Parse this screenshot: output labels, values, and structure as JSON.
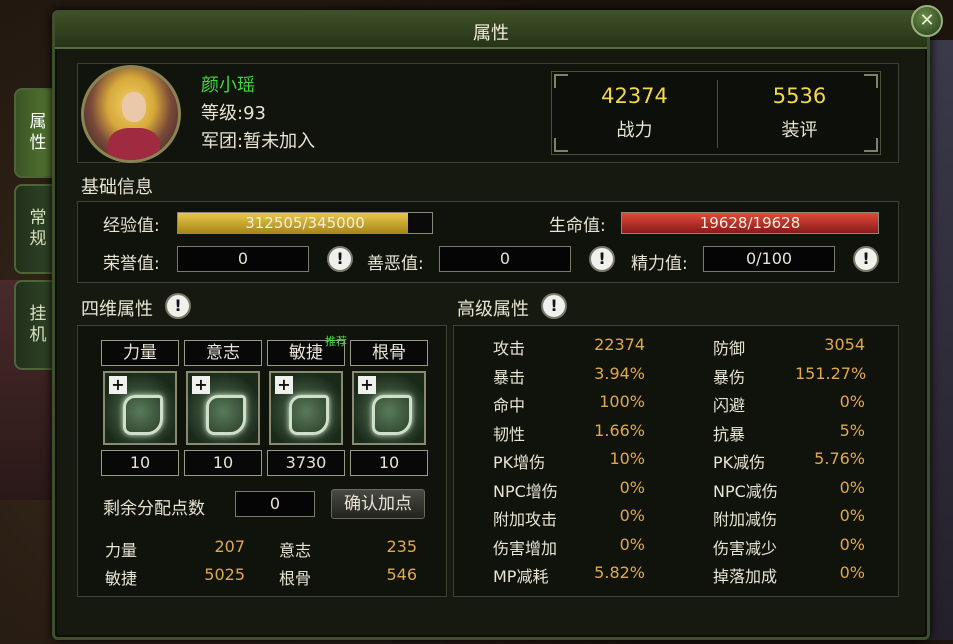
{
  "window": {
    "title": "属性",
    "close_icon": "✕"
  },
  "side_tabs": [
    "属性",
    "常规",
    "挂机"
  ],
  "player": {
    "name": "颜小瑶",
    "level": "等级:93",
    "guild": "军团:暂未加入"
  },
  "power": {
    "value": "42374",
    "label": "战力"
  },
  "gear_score": {
    "value": "5536",
    "label": "装评"
  },
  "basic": {
    "title": "基础信息",
    "exp_label": "经验值:",
    "exp_text": "312505/345000",
    "exp_ratio": 0.906,
    "hp_label": "生命值:",
    "hp_text": "19628/19628",
    "hp_ratio": 1.0,
    "honor_label": "荣誉值:",
    "honor_value": "0",
    "karma_label": "善恶值:",
    "karma_value": "0",
    "energy_label": "精力值:",
    "energy_value": "0/100",
    "info_icon": "!"
  },
  "four_attrs": {
    "title": "四维属性",
    "recommend": "推荐",
    "plus_icon": "+",
    "items": [
      {
        "name": "力量",
        "value": "10"
      },
      {
        "name": "意志",
        "value": "10"
      },
      {
        "name": "敏捷",
        "value": "3730"
      },
      {
        "name": "根骨",
        "value": "10"
      }
    ],
    "remaining_label": "剩余分配点数",
    "remaining_value": "0",
    "confirm_label": "确认加点",
    "totals": [
      {
        "name": "力量",
        "value": "207"
      },
      {
        "name": "意志",
        "value": "235"
      },
      {
        "name": "敏捷",
        "value": "5025"
      },
      {
        "name": "根骨",
        "value": "546"
      }
    ]
  },
  "advanced": {
    "title": "高级属性",
    "rows": [
      {
        "l": "攻击",
        "lv": "22374",
        "r": "防御",
        "rv": "3054"
      },
      {
        "l": "暴击",
        "lv": "3.94%",
        "r": "暴伤",
        "rv": "151.27%"
      },
      {
        "l": "命中",
        "lv": "100%",
        "r": "闪避",
        "rv": "0%"
      },
      {
        "l": "韧性",
        "lv": "1.66%",
        "r": "抗暴",
        "rv": "5%"
      },
      {
        "l": "PK增伤",
        "lv": "10%",
        "r": "PK减伤",
        "rv": "5.76%"
      },
      {
        "l": "NPC增伤",
        "lv": "0%",
        "r": "NPC减伤",
        "rv": "0%"
      },
      {
        "l": "附加攻击",
        "lv": "0%",
        "r": "附加减伤",
        "rv": "0%"
      },
      {
        "l": "伤害增加",
        "lv": "0%",
        "r": "伤害减少",
        "rv": "0%"
      },
      {
        "l": "MP减耗",
        "lv": "5.82%",
        "r": "掉落加成",
        "rv": "0%"
      }
    ]
  }
}
